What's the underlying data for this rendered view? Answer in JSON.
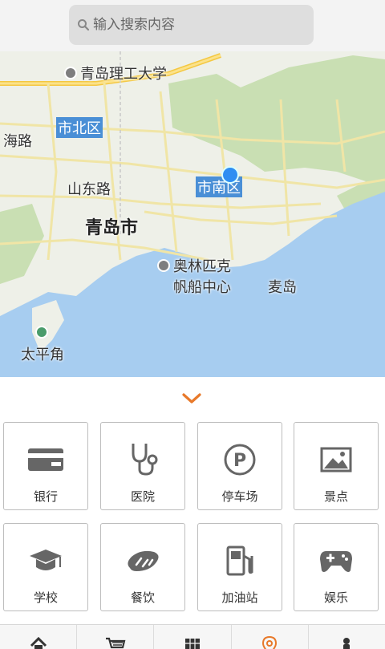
{
  "search": {
    "placeholder": "输入搜索内容"
  },
  "map": {
    "labels": {
      "university": "青岛理工大学",
      "shibei": "市北区",
      "haihai_road": "海路",
      "shandong_road": "山东路",
      "city": "青岛市",
      "shinan": "市南区",
      "olympic_line1": "奥林匹克",
      "olympic_line2": "帆船中心",
      "maidao": "麦岛",
      "taipingjiao": "太平角"
    }
  },
  "categories": [
    {
      "label": "银行",
      "icon": "bank-card-icon"
    },
    {
      "label": "医院",
      "icon": "stethoscope-icon"
    },
    {
      "label": "停车场",
      "icon": "parking-icon"
    },
    {
      "label": "景点",
      "icon": "landscape-icon"
    },
    {
      "label": "学校",
      "icon": "graduation-cap-icon"
    },
    {
      "label": "餐饮",
      "icon": "bread-icon"
    },
    {
      "label": "加油站",
      "icon": "gas-pump-icon"
    },
    {
      "label": "娱乐",
      "icon": "gamepad-icon"
    }
  ],
  "nav": {
    "items": [
      "home-icon",
      "cart-icon",
      "grid-icon",
      "location-pin-icon",
      "person-icon"
    ],
    "active_color": "#e8792a"
  },
  "colors": {
    "accent": "#e8792a",
    "water": "#a7cdf0",
    "land": "#eef0e8",
    "park": "#c9dfb3",
    "district": "#4a8fd6"
  }
}
